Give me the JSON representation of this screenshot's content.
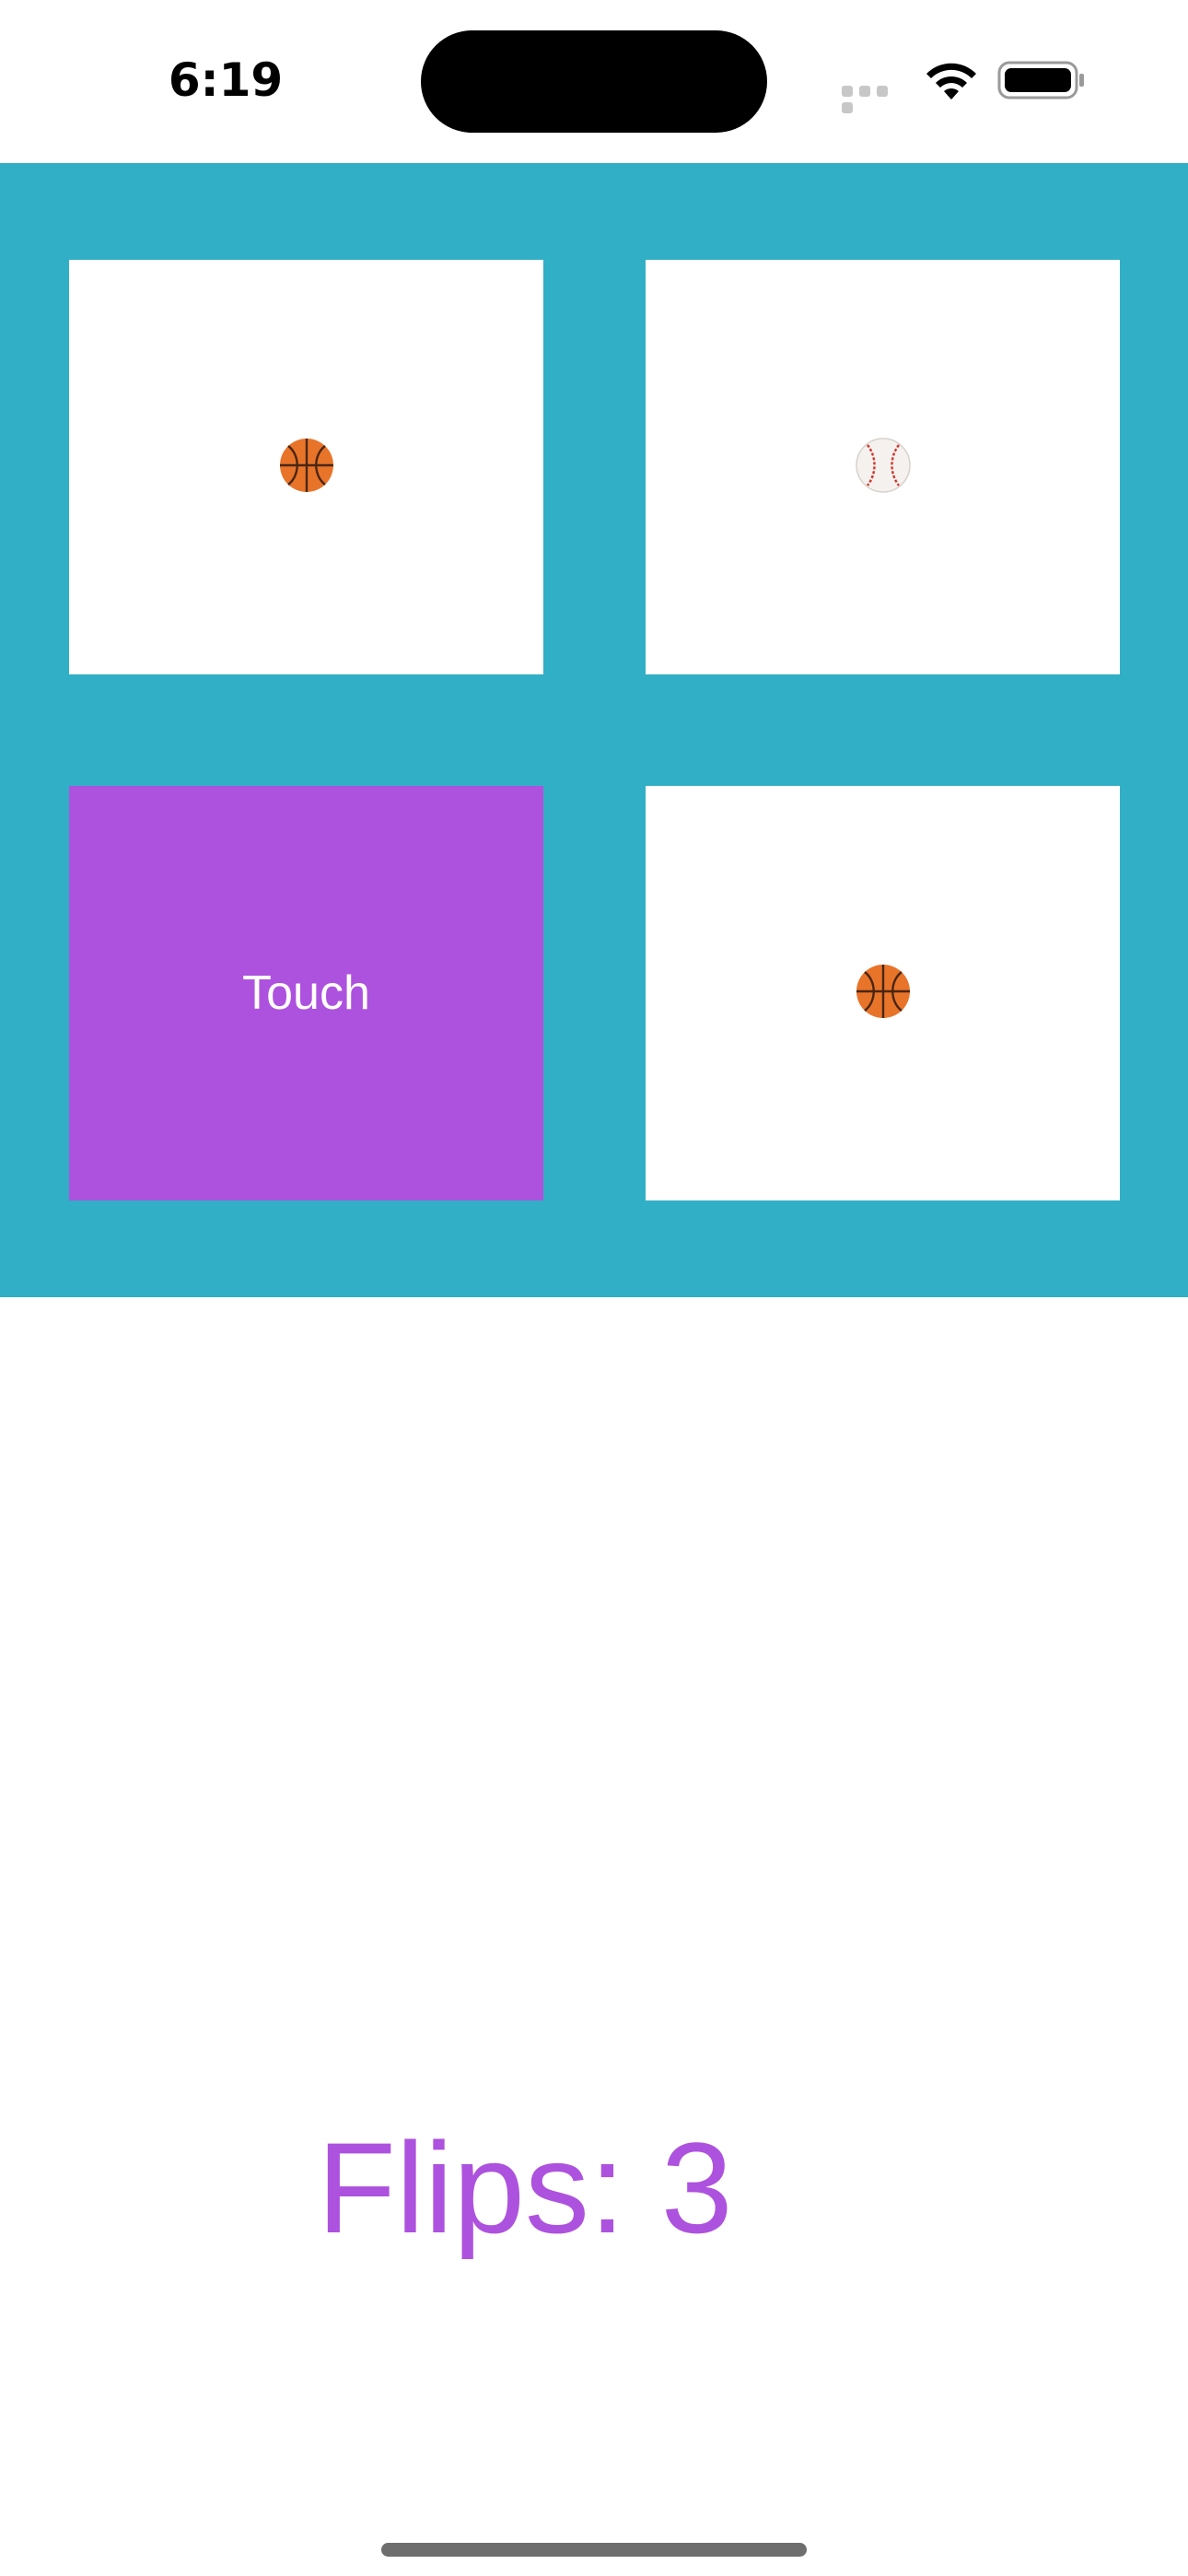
{
  "status_bar": {
    "time": "6:19",
    "signal_icon": "cellular-signal-icon",
    "wifi_icon": "wifi-icon",
    "battery_icon": "battery-icon"
  },
  "board": {
    "background_color": "#31afc6",
    "card_face_color": "#ffffff",
    "card_back_color": "#ad52de",
    "cards": [
      {
        "state": "face-up",
        "emoji": "basketball",
        "label": ""
      },
      {
        "state": "face-up",
        "emoji": "baseball",
        "label": ""
      },
      {
        "state": "face-down",
        "emoji": "",
        "label": "Touch"
      },
      {
        "state": "face-up",
        "emoji": "basketball",
        "label": ""
      }
    ]
  },
  "flips": {
    "text": "Flips: 3",
    "color": "#ad52de"
  }
}
